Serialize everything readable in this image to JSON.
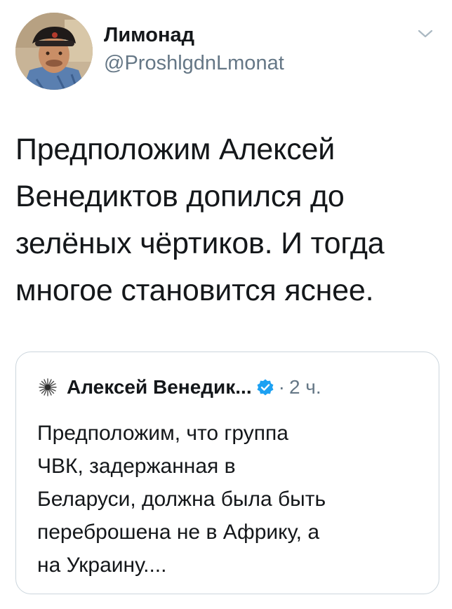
{
  "tweet": {
    "author": {
      "display_name": "Лимонад",
      "handle": "@ProshlgdnLmonat",
      "avatar_icon": "user-avatar-photo"
    },
    "menu_icon": "chevron-down-icon",
    "text": "Предположим Алексей\nВенедиктов допился до\nзелёных чёртиков. И тогда\nмногое становится яснее."
  },
  "quoted_tweet": {
    "author_name": "Алексей Венедик...",
    "verified_icon": "verified-badge-icon",
    "separator": "·",
    "time": "2 ч.",
    "text": "Предположим, что группа\nЧВК, задержанная в\nБеларуси, должна была быть\nпереброшена не в Африку, а\nна Украину...."
  },
  "colors": {
    "text": "#14171a",
    "secondary": "#657786",
    "border": "#ccd6dd",
    "verified": "#1da1f2"
  }
}
